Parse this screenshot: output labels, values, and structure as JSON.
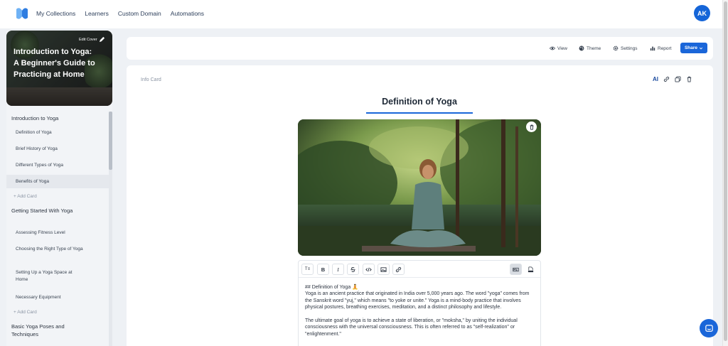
{
  "nav": {
    "links": [
      "My Collections",
      "Learners",
      "Custom Domain",
      "Automations"
    ],
    "avatar_initials": "AK",
    "accent_color": "#1a66d9"
  },
  "sidebar": {
    "cover_title": "Introduction to Yoga: A Beginner's Guide to Practicing at Home",
    "edit_cover_label": "Edit Cover",
    "sections": [
      {
        "title": "Introduction to Yoga",
        "items": [
          "Definition of Yoga",
          "Brief History of Yoga",
          "Different Types of Yoga",
          "Benefits of Yoga"
        ],
        "active_item": "Benefits of Yoga",
        "add_label": "+ Add Card"
      },
      {
        "title": "Getting Started With Yoga",
        "items": [
          "Assessing Fitness Level",
          "Choosing the Right Type of Yoga",
          "Setting Up a Yoga Space at Home",
          "Necessary Equipment"
        ],
        "add_label": "+ Add Card"
      },
      {
        "title": "Basic Yoga Poses and Techniques",
        "items": []
      }
    ]
  },
  "toolbar": {
    "view": "View",
    "theme": "Theme",
    "settings": "Settings",
    "report": "Report",
    "share": "Share"
  },
  "card": {
    "type_label": "Info Card",
    "ai_label": "AI",
    "title": "Definition of Yoga",
    "image_icon": "trash-icon",
    "editor": {
      "tools": [
        "text-format-icon",
        "bold-icon",
        "italic-icon",
        "strikethrough-icon",
        "code-icon",
        "image-icon",
        "link-icon",
        "markdown-icon",
        "html-icon"
      ],
      "bold_label": "B",
      "italic_label": "I",
      "text_format_label": "T≡",
      "heading_line": "## Definition of Yoga 🧘",
      "paragraph_1": "Yoga is an ancient practice that originated in India over 5,000 years ago. The word \"yoga\" comes from the Sanskrit word \"yuj,\" which means \"to yoke or unite.\" Yoga is a mind-body practice that involves physical postures, breathing exercises, meditation, and a distinct philosophy and lifestyle.",
      "paragraph_2": "The ultimate goal of yoga is to achieve a state of liberation, or \"moksha,\" by uniting the individual consciousness with the universal consciousness. This is often referred to as \"self-realization\" or \"enlightenment.\""
    }
  }
}
